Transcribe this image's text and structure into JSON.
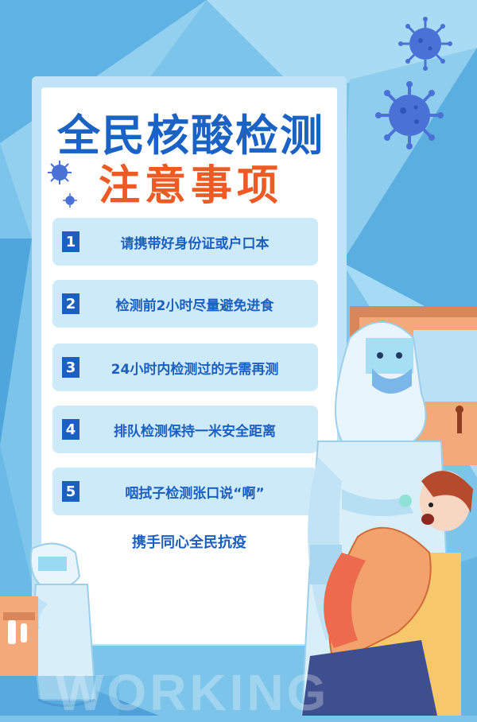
{
  "poster": {
    "title": "全民核酸检测",
    "subtitle": "注意事项",
    "items": [
      {
        "num": "1",
        "text": "请携带好身份证或户口本"
      },
      {
        "num": "2",
        "text": "检测前2小时尽量避免进食"
      },
      {
        "num": "3",
        "text": "24小时内检测过的无需再测"
      },
      {
        "num": "4",
        "text": "排队检测保持一米安全距离"
      },
      {
        "num": "5",
        "text": "咽拭子检测张口说“啊”"
      }
    ],
    "slogan": "携手同心全民抗疫",
    "watermark": "WORKING"
  },
  "colors": {
    "background": "#7cc4ea",
    "title": "#1a63c4",
    "subtitle": "#ee5a23",
    "item_bg": "#cdeaf8",
    "number_bg": "#1b5fc0",
    "virus": "#4a72d6"
  },
  "icons": [
    "virus-icon",
    "medical-worker-illustration",
    "patient-illustration",
    "door-illustration",
    "testing-booth-illustration"
  ]
}
